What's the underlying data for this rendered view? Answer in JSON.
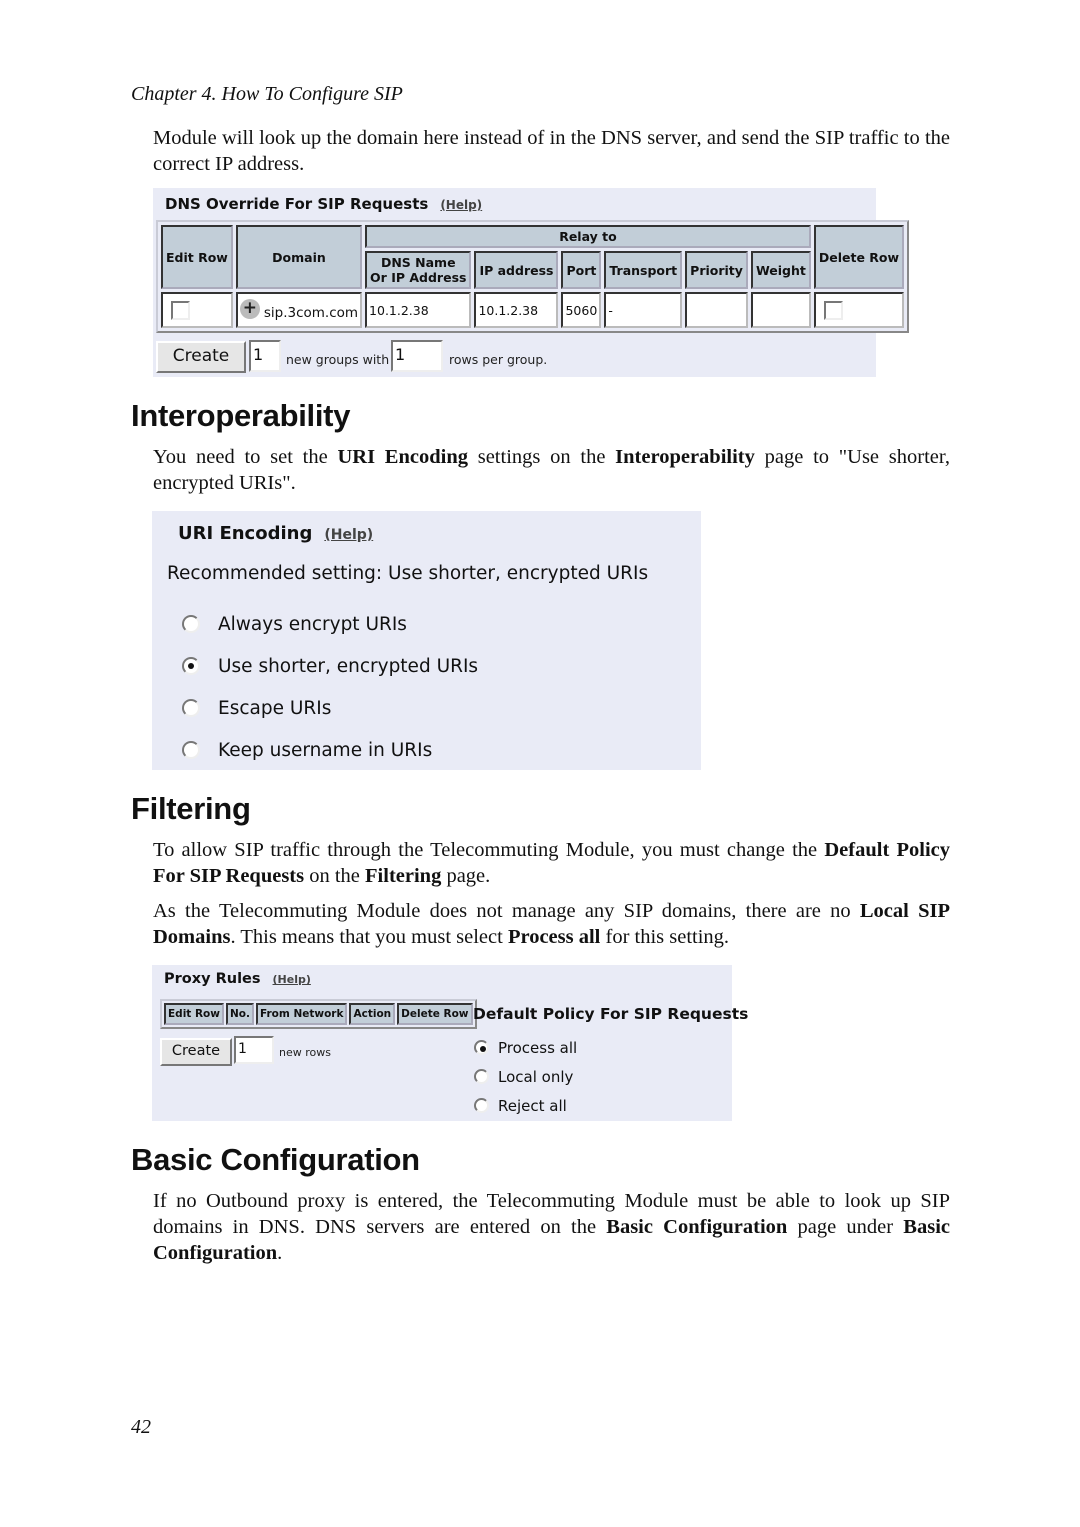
{
  "running_head": "Chapter 4. How To Configure SIP",
  "intro_paragraph": "Module will look up the domain here instead of in the DNS server, and send the SIP traffic to the correct IP address.",
  "dns_override": {
    "title": "DNS Override For SIP Requests",
    "help_label": "(Help)",
    "headers": {
      "edit_row": "Edit Row",
      "domain": "Domain",
      "relay_to": "Relay to",
      "dns_name_line1": "DNS Name",
      "dns_name_line2": "Or IP Address",
      "ip_address": "IP address",
      "port": "Port",
      "transport": "Transport",
      "priority": "Priority",
      "weight": "Weight",
      "delete_row": "Delete Row"
    },
    "rows": [
      {
        "edit_checked": false,
        "domain": "sip.3com.com",
        "dns_name": "10.1.2.38",
        "ip_address": "10.1.2.38",
        "port": "5060",
        "transport": "-",
        "priority": "",
        "weight": "",
        "delete_checked": false
      }
    ],
    "create_label": "Create",
    "groups_value": "1",
    "groups_label": "new groups with",
    "rows_value": "1",
    "rows_label": "rows per group."
  },
  "interoperability": {
    "heading": "Interoperability",
    "paragraph": {
      "t1": "You need to set the ",
      "b1": "URI Encoding",
      "t2": " settings on the ",
      "b2": "Interoperability",
      "t3": " page to \"Use shorter, encrypted URIs\"."
    },
    "panel": {
      "title": "URI Encoding",
      "help_label": "(Help)",
      "recommendation": "Recommended setting: Use shorter, encrypted URIs",
      "options": [
        {
          "label": "Always encrypt URIs",
          "selected": false
        },
        {
          "label": "Use shorter, encrypted URIs",
          "selected": true
        },
        {
          "label": "Escape URIs",
          "selected": false
        },
        {
          "label": "Keep username in URIs",
          "selected": false
        }
      ]
    }
  },
  "filtering": {
    "heading": "Filtering",
    "paragraph1": {
      "t1": "To allow SIP traffic through the Telecommuting Module, you must change the ",
      "b1": "Default Policy For SIP Requests",
      "t2": " on the ",
      "b2": "Filtering",
      "t3": " page."
    },
    "paragraph2": {
      "t1": "As the Telecommuting Module does not manage any SIP domains, there are no ",
      "b1": "Local SIP Domains",
      "t2": ". This means that you must select ",
      "b2": "Process all",
      "t3": " for this setting."
    },
    "proxy_rules": {
      "title": "Proxy Rules",
      "help_label": "(Help)",
      "headers": [
        "Edit Row",
        "No.",
        "From Network",
        "Action",
        "Delete Row"
      ],
      "create_label": "Create",
      "rows_value": "1",
      "rows_label": "new rows"
    },
    "default_policy": {
      "title": "Default Policy For SIP Requests",
      "options": [
        {
          "label": "Process all",
          "selected": true
        },
        {
          "label": "Local only",
          "selected": false
        },
        {
          "label": "Reject all",
          "selected": false
        }
      ]
    }
  },
  "basic_configuration": {
    "heading": "Basic Configuration",
    "paragraph": {
      "t1": "If no Outbound proxy is entered, the Telecommuting Module must be able to look up SIP domains in DNS. DNS servers are entered on the ",
      "b1": "Basic Configuration",
      "t2": " page under ",
      "b2": "Basic Configuration",
      "t3": "."
    }
  },
  "page_number": "42"
}
